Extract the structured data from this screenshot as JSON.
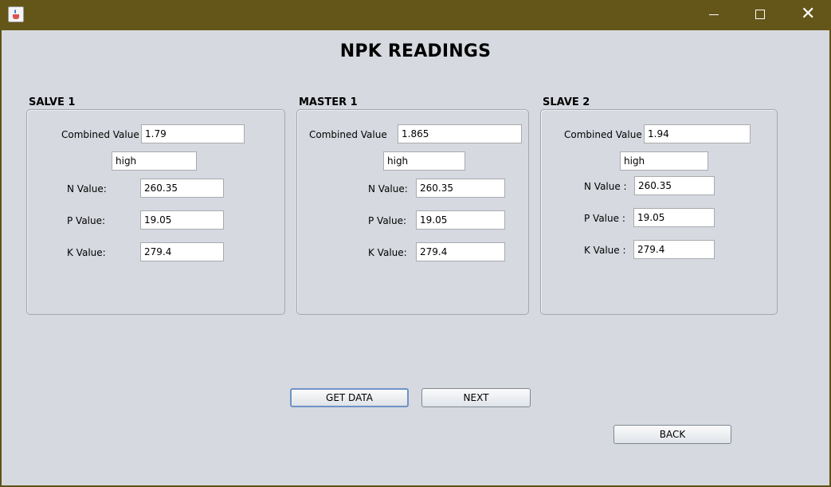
{
  "window": {
    "icon": "java-cup-icon",
    "controls": {
      "minimize": "minimize-icon",
      "maximize": "maximize-icon",
      "close_glyph": "✕"
    }
  },
  "page_title": "NPK READINGS",
  "panels": [
    {
      "title": "SALVE 1",
      "combined_label": "Combined Value",
      "combined_value": "1.79",
      "status_value": "high",
      "n_label": "N Value:",
      "n_value": "260.35",
      "p_label": "P Value:",
      "p_value": "19.05",
      "k_label": "K Value:",
      "k_value": "279.4"
    },
    {
      "title": "MASTER 1",
      "combined_label": "Combined Value",
      "combined_value": "1.865",
      "status_value": "high",
      "n_label": "N Value:",
      "n_value": "260.35",
      "p_label": "P Value:",
      "p_value": "19.05",
      "k_label": "K Value:",
      "k_value": "279.4"
    },
    {
      "title": "SLAVE 2",
      "combined_label": "Combined Value",
      "combined_value": "1.94",
      "status_value": "high",
      "n_label": "N Value :",
      "n_value": "260.35",
      "p_label": "P Value :",
      "p_value": "19.05",
      "k_label": "K Value :",
      "k_value": "279.4"
    }
  ],
  "buttons": {
    "get_data": "GET DATA",
    "next": "NEXT",
    "back": "BACK"
  },
  "colors": {
    "titlebar": "#645619",
    "background": "#d6d9df",
    "focus_border": "#6f93c7"
  }
}
